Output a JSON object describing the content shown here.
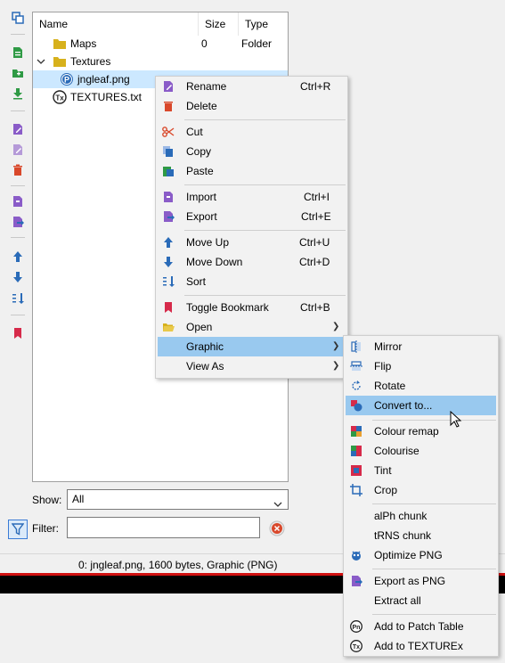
{
  "tree": {
    "headers": {
      "name": "Name",
      "size": "Size",
      "type": "Type"
    },
    "rows": [
      {
        "name": "Maps",
        "size": "0",
        "type": "Folder",
        "icon": "folder-icon"
      },
      {
        "name": "Textures",
        "size": "",
        "type": "",
        "icon": "folder-icon"
      },
      {
        "name": "jngleaf.png",
        "size": "",
        "type": "",
        "icon": "png-file-icon"
      },
      {
        "name": "TEXTURES.txt",
        "size": "",
        "type": "",
        "icon": "texture-file-icon"
      }
    ]
  },
  "show": {
    "label": "Show:",
    "value": "All"
  },
  "filter": {
    "label": "Filter:",
    "value": ""
  },
  "status": {
    "text": "0: jngleaf.png, 1600 bytes, Graphic (PNG)"
  },
  "context_menu": {
    "items": [
      {
        "label": "Rename",
        "shortcut": "Ctrl+R",
        "icon": "rename-icon"
      },
      {
        "label": "Delete",
        "shortcut": "",
        "icon": "delete-icon"
      },
      {
        "label": "Cut",
        "shortcut": "",
        "icon": "cut-icon"
      },
      {
        "label": "Copy",
        "shortcut": "",
        "icon": "copy-icon"
      },
      {
        "label": "Paste",
        "shortcut": "",
        "icon": "paste-icon"
      },
      {
        "label": "Import",
        "shortcut": "Ctrl+I",
        "icon": "import-icon"
      },
      {
        "label": "Export",
        "shortcut": "Ctrl+E",
        "icon": "export-icon"
      },
      {
        "label": "Move Up",
        "shortcut": "Ctrl+U",
        "icon": "move-up-icon"
      },
      {
        "label": "Move Down",
        "shortcut": "Ctrl+D",
        "icon": "move-down-icon"
      },
      {
        "label": "Sort",
        "shortcut": "",
        "icon": "sort-icon"
      },
      {
        "label": "Toggle Bookmark",
        "shortcut": "Ctrl+B",
        "icon": "bookmark-icon"
      },
      {
        "label": "Open",
        "shortcut": "",
        "icon": "open-folder-icon"
      },
      {
        "label": "Graphic",
        "shortcut": "",
        "icon": ""
      },
      {
        "label": "View As",
        "shortcut": "",
        "icon": ""
      }
    ]
  },
  "graphic_menu": {
    "items": [
      {
        "label": "Mirror",
        "icon": "mirror-icon"
      },
      {
        "label": "Flip",
        "icon": "flip-icon"
      },
      {
        "label": "Rotate",
        "icon": "rotate-icon"
      },
      {
        "label": "Convert to...",
        "icon": "convert-icon"
      },
      {
        "label": "Colour remap",
        "icon": "colour-remap-icon"
      },
      {
        "label": "Colourise",
        "icon": "colourise-icon"
      },
      {
        "label": "Tint",
        "icon": "tint-icon"
      },
      {
        "label": "Crop",
        "icon": "crop-icon"
      },
      {
        "label": "alPh chunk",
        "icon": ""
      },
      {
        "label": "tRNS chunk",
        "icon": ""
      },
      {
        "label": "Optimize PNG",
        "icon": "optimize-png-icon"
      },
      {
        "label": "Export as PNG",
        "icon": "export-png-icon"
      },
      {
        "label": "Extract all",
        "icon": ""
      },
      {
        "label": "Add to Patch Table",
        "icon": "patch-table-icon"
      },
      {
        "label": "Add to TEXTUREx",
        "icon": "texturex-icon"
      }
    ]
  },
  "colors": {
    "highlight": "#99c9ef",
    "selection": "#cce8ff",
    "accent": "#3a7bd5"
  }
}
